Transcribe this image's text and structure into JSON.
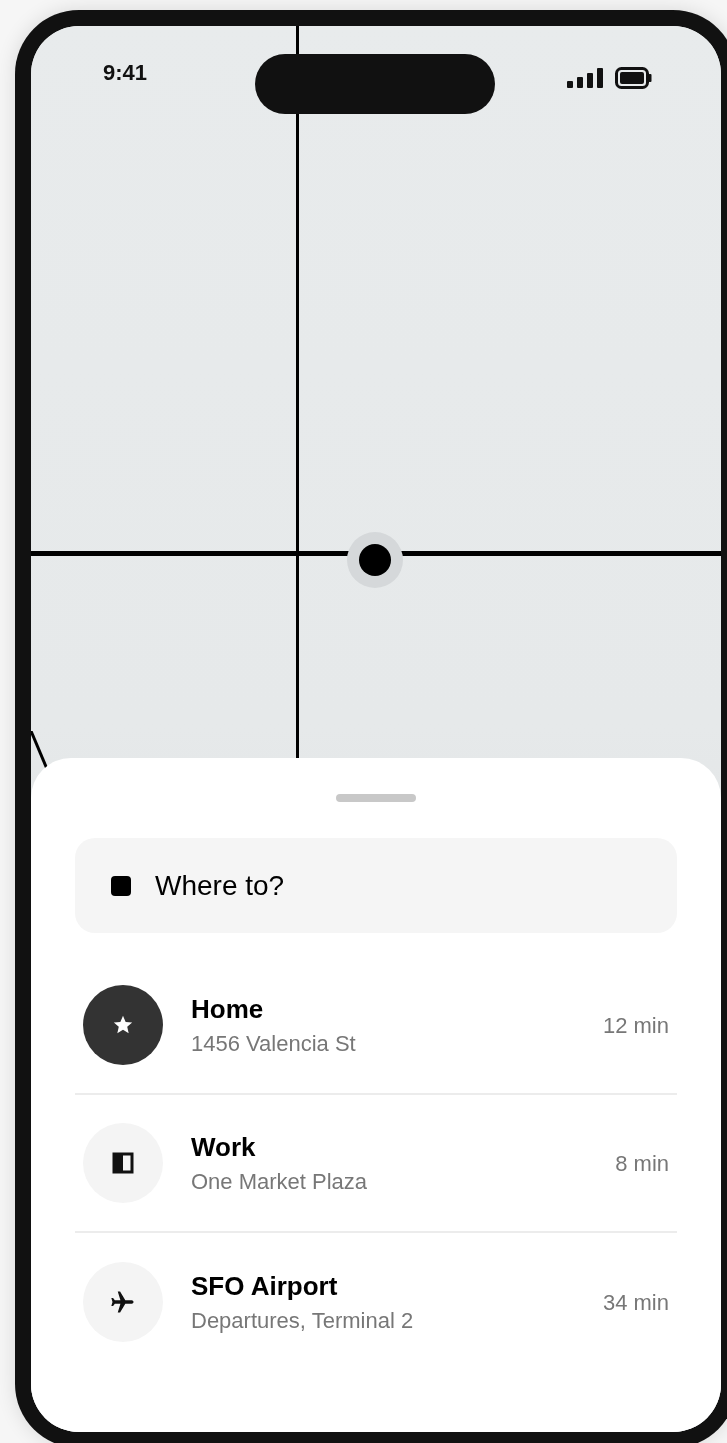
{
  "status_bar": {
    "time": "9:41"
  },
  "search": {
    "placeholder": "Where to?"
  },
  "destinations": [
    {
      "kind": "star",
      "highlighted": true,
      "title": "Home",
      "subtitle": "1456 Valencia St",
      "eta": "12 min"
    },
    {
      "kind": "building",
      "highlighted": false,
      "title": "Work",
      "subtitle": "One Market Plaza",
      "eta": "8 min"
    },
    {
      "kind": "plane",
      "highlighted": false,
      "title": "SFO Airport",
      "subtitle": "Departures, Terminal 2",
      "eta": "34 min"
    }
  ]
}
